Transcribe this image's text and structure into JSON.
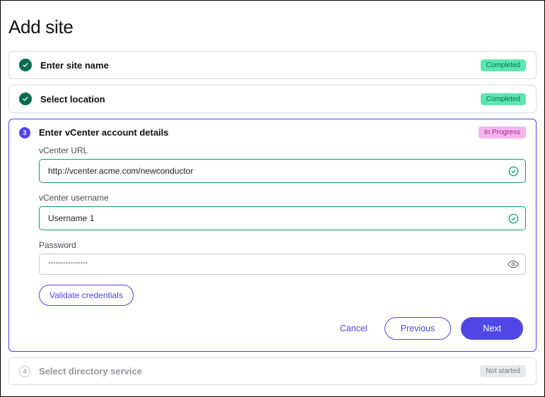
{
  "page": {
    "title": "Add site"
  },
  "steps": {
    "s1": {
      "title": "Enter site name",
      "status": "Completed"
    },
    "s2": {
      "title": "Select location",
      "status": "Completed"
    },
    "s3": {
      "number": "3",
      "title": "Enter vCenter account details",
      "status": "In Progress",
      "fields": {
        "url": {
          "label": "vCenter URL",
          "value": "http://vcenter.acme.com/newconductor"
        },
        "username": {
          "label": "vCenter username",
          "value": "Username 1"
        },
        "password": {
          "label": "Password",
          "value": "****************"
        }
      },
      "validate_label": "Validate credentials",
      "actions": {
        "cancel": "Cancel",
        "previous": "Previous",
        "next": "Next"
      }
    },
    "s4": {
      "number": "4",
      "title": "Select directory service",
      "status": "Not started"
    }
  }
}
